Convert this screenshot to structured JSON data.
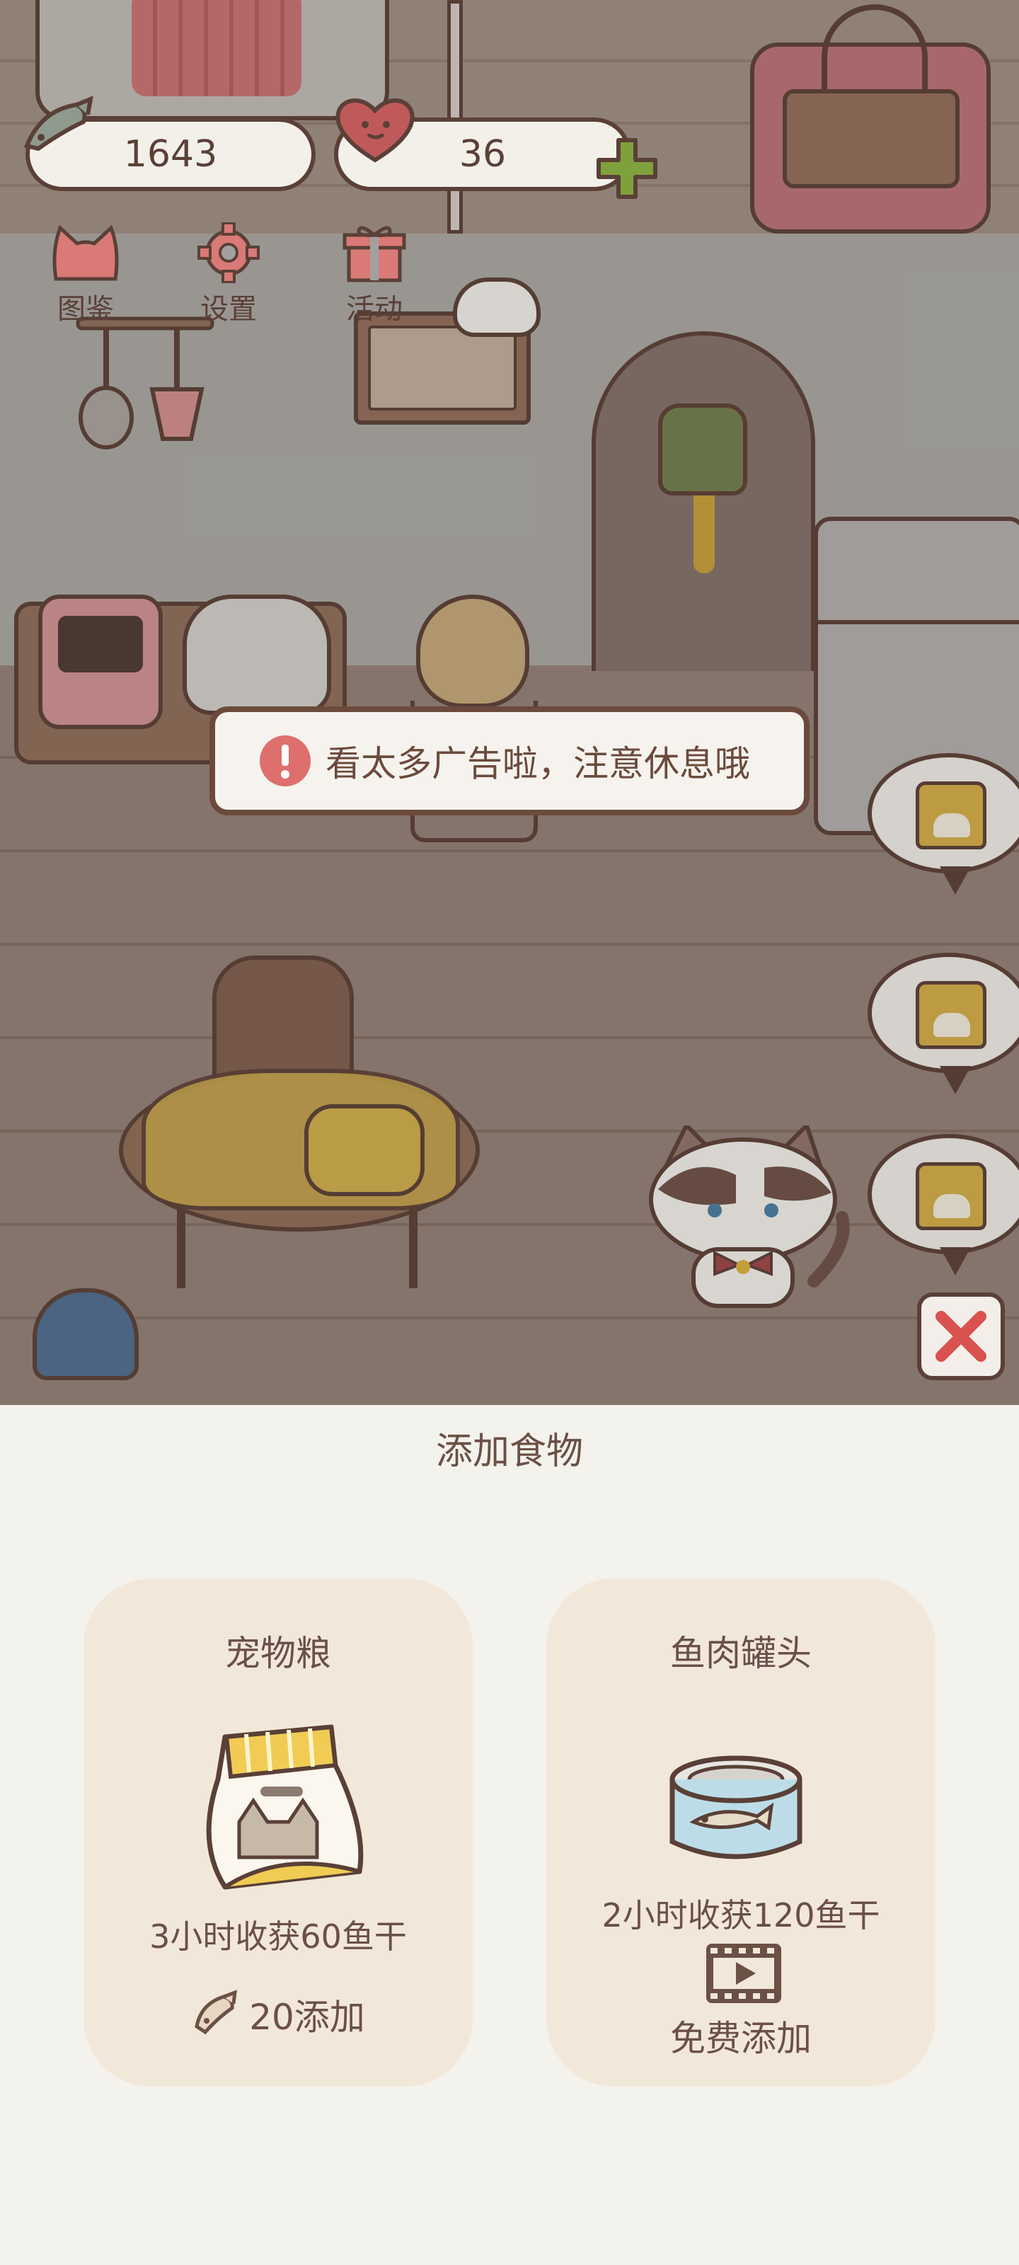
{
  "resources": {
    "fish": "1643",
    "hearts": "36"
  },
  "nav": {
    "atlas": "图鉴",
    "settings": "设置",
    "events": "活动"
  },
  "toast": {
    "text": "看太多广告啦，注意休息哦"
  },
  "sheet": {
    "title": "添加食物",
    "cards": [
      {
        "name": "宠物粮",
        "desc": "3小时收获60鱼干",
        "action": "20添加",
        "action_icon": "fish-icon"
      },
      {
        "name": "鱼肉罐头",
        "desc": "2小时收获120鱼干",
        "action": "免费添加",
        "action_icon": "video-icon"
      }
    ]
  },
  "colors": {
    "outline": "#5a4037",
    "accent_red": "#d97a77",
    "plus_green": "#7fa13c",
    "card_bg": "#f2e8da",
    "sheet_bg": "#f4f2ed"
  }
}
